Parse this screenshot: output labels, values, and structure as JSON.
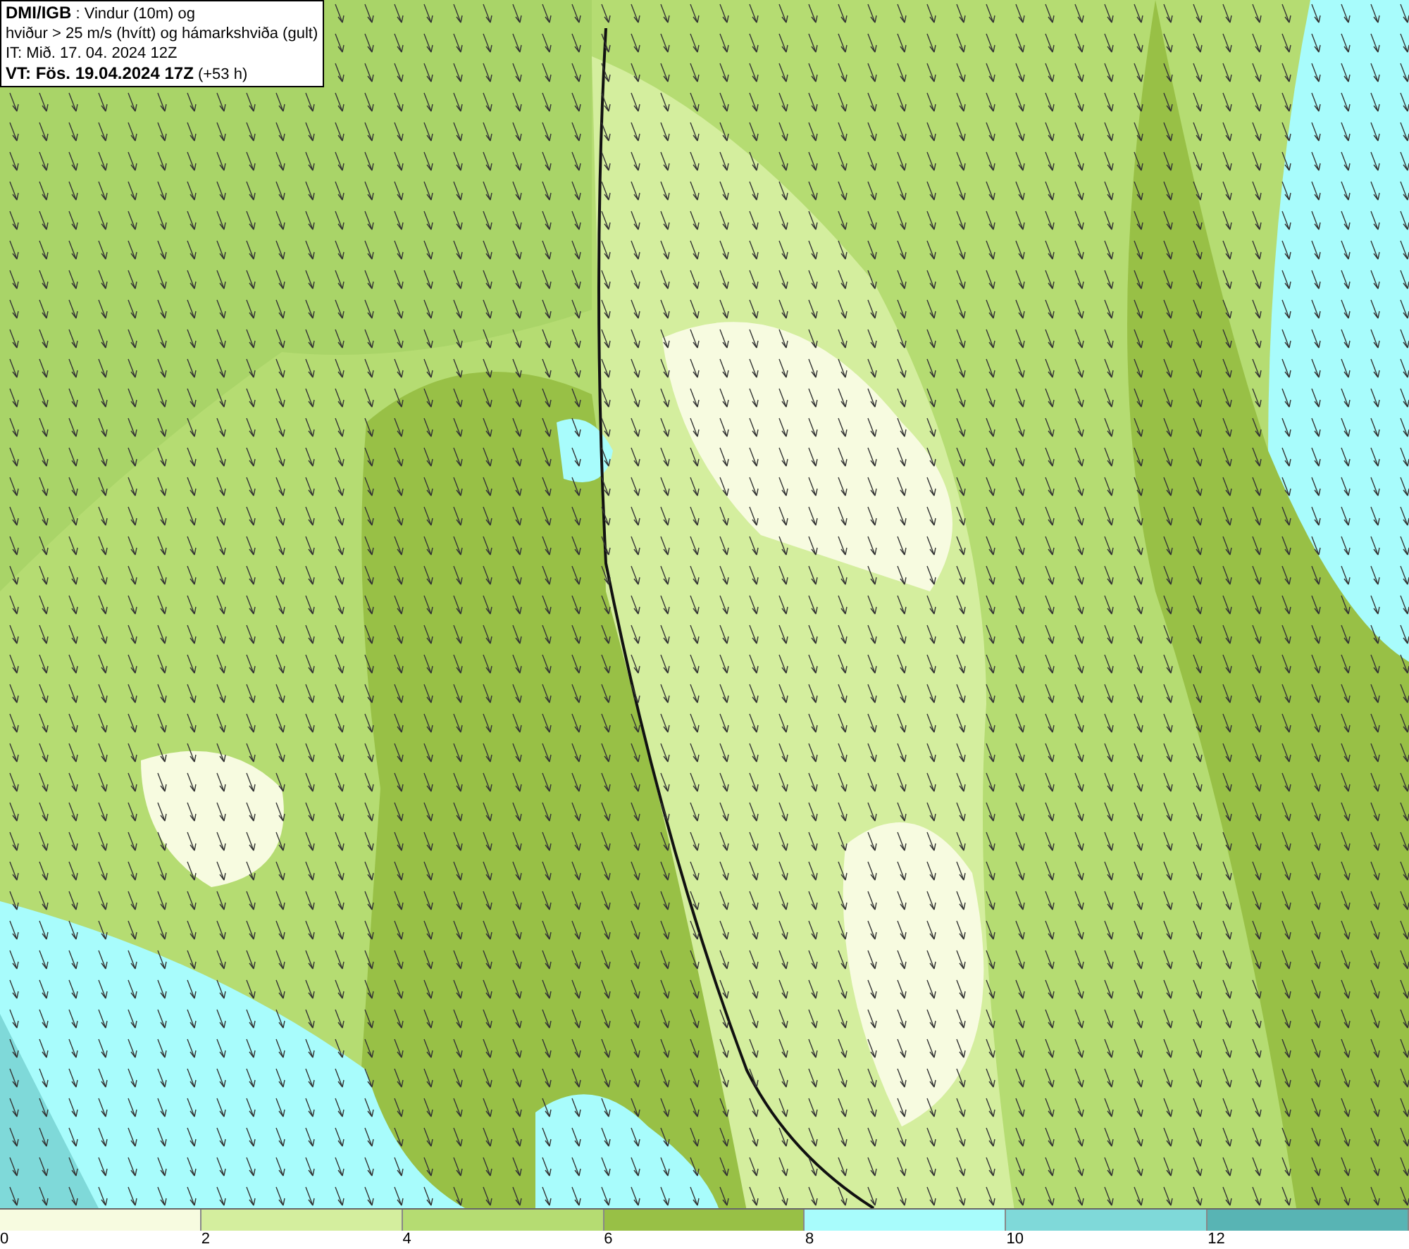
{
  "title_box": {
    "lines": [
      "**DMI/IGB** : Vindur (10m) og",
      "hviður > 25 m/s (hvítt) og hámarkshviða (gult)",
      "IT: Mið. 17. 04. 2024 12Z",
      "**VT: Fös. 19.04.2024 17Z** (+53 h)"
    ]
  },
  "legend": {
    "bins": [
      {
        "color": "#f7fbe0"
      },
      {
        "color": "#d4ee9e"
      },
      {
        "color": "#b5dc72"
      },
      {
        "color": "#98c046"
      },
      {
        "color": "#a8fcfc"
      },
      {
        "color": "#7fd9d9"
      },
      {
        "color": "#58b4b4"
      }
    ],
    "ticks": [
      "0",
      "2",
      "4",
      "6",
      "8",
      "10",
      "12"
    ]
  }
}
